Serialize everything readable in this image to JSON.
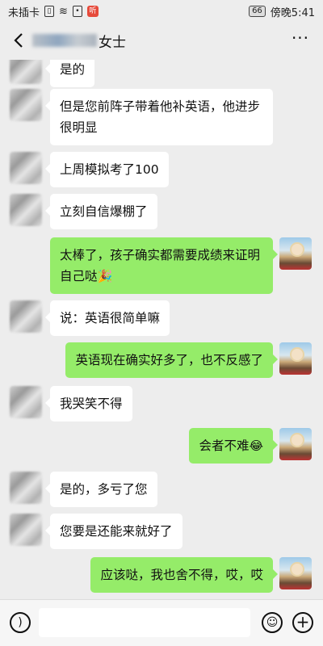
{
  "status_bar": {
    "carrier": "未插卡",
    "time": "傍晚5:41",
    "battery": "66",
    "notification": "听"
  },
  "header": {
    "title_suffix": "女士"
  },
  "messages": [
    {
      "side": "left",
      "text": "是的"
    },
    {
      "side": "left",
      "text": "但是您前阵子带着他补英语，他进步很明显"
    },
    {
      "side": "left",
      "text": "上周模拟考了100"
    },
    {
      "side": "left",
      "text": "立刻自信爆棚了"
    },
    {
      "side": "right",
      "text": "太棒了，孩子确实都需要成绩来证明自己哒",
      "emoji": "🎉"
    },
    {
      "side": "left",
      "text": "说：英语很简单嘛"
    },
    {
      "side": "right",
      "text": "英语现在确实好多了，也不反感了"
    },
    {
      "side": "left",
      "text": "我哭笑不得"
    },
    {
      "side": "right",
      "text": "会者不难",
      "emoji": "😂"
    },
    {
      "side": "left",
      "text": "是的，多亏了您"
    },
    {
      "side": "left",
      "text": "您要是还能来就好了"
    },
    {
      "side": "right",
      "text": "应该哒，我也舍不得，哎，哎"
    }
  ],
  "input": {
    "value": ""
  }
}
